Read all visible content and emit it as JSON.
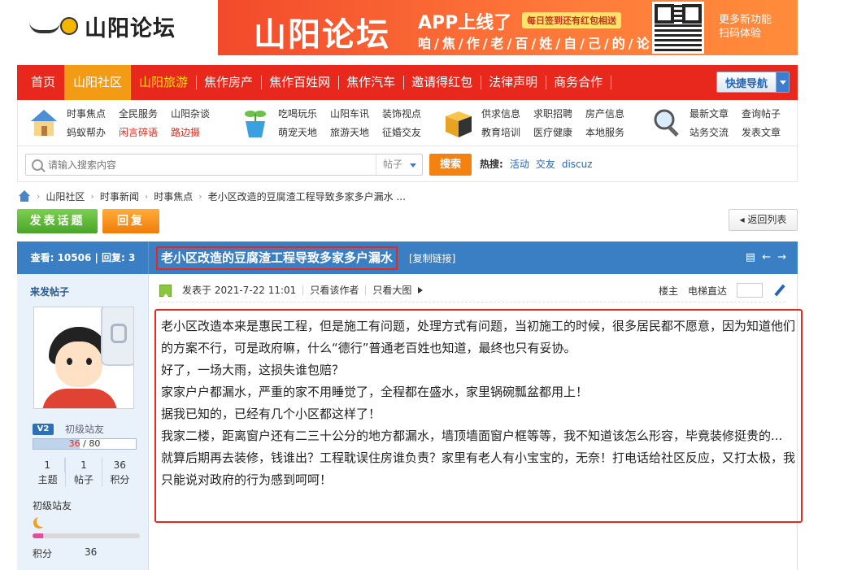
{
  "header": {
    "logo_text": "山阳论坛",
    "banner": {
      "title": "山阳论坛",
      "app_text": "APP上线了",
      "sign_badge": "每日签到还有红包相送",
      "slogan": "咱/焦/作/老/百/姓/自/己/的/论/坛",
      "qr_text_1": "更多新功能",
      "qr_text_2": "扫码体验"
    }
  },
  "nav": {
    "items": [
      {
        "label": "首页"
      },
      {
        "label": "山阳社区"
      },
      {
        "label": "山阳旅游"
      },
      {
        "label": "焦作房产"
      },
      {
        "label": "焦作百姓网"
      },
      {
        "label": "焦作汽车"
      },
      {
        "label": "邀请得红包"
      },
      {
        "label": "法律声明"
      },
      {
        "label": "商务合作"
      }
    ],
    "quick_nav": "快捷导航",
    "colors": {
      "bar": "#e8281c",
      "active": "#f49b16",
      "highlight": "#ffe000"
    }
  },
  "categories": [
    {
      "icon": "house-icon",
      "links": [
        "时事焦点",
        "全民服务",
        "山阳杂谈",
        "蚂蚁帮办",
        "闲言碎语",
        "路边摄"
      ],
      "red": [
        4,
        5
      ]
    },
    {
      "icon": "plant-pot-icon",
      "links": [
        "吃喝玩乐",
        "山阳车讯",
        "装饰视点",
        "萌宠天地",
        "旅游天地",
        "征婚交友"
      ],
      "red": []
    },
    {
      "icon": "box-icon",
      "links": [
        "供求信息",
        "求职招聘",
        "房产信息",
        "教育培训",
        "医疗健康",
        "本地服务"
      ],
      "red": []
    },
    {
      "icon": "magnifier-icon",
      "links": [
        "最新文章",
        "查询帖子",
        "站务交流",
        "发表文章"
      ],
      "red": []
    }
  ],
  "search": {
    "placeholder": "请输入搜索内容",
    "type": "帖子",
    "button": "搜索",
    "hot_label": "热搜:",
    "hot_terms": [
      "活动",
      "交友",
      "discuz"
    ]
  },
  "breadcrumb": [
    "山阳社区",
    "时事新闻",
    "时事焦点",
    "老小区改造的豆腐渣工程导致多家多户漏水 ..."
  ],
  "actions": {
    "post": "发表话题",
    "reply": "回复",
    "back": "返回列表"
  },
  "thread": {
    "stats": "查看: 10506 | 回复: 3",
    "title": "老小区改造的豆腐渣工程导致多家多户漏水",
    "copy_link": "[复制链接]"
  },
  "author": {
    "poster_label": "来发帖子",
    "level_badge": "V2",
    "level_name": "初级站友",
    "credit_current": "36",
    "credit_max": "80",
    "credit_sep": " / ",
    "credit_progress": 0.45,
    "counts": [
      {
        "value": "1",
        "label": "主题"
      },
      {
        "value": "1",
        "label": "帖子"
      },
      {
        "value": "36",
        "label": "积分"
      }
    ],
    "level_name_2": "初级站友",
    "star_progress": 0.1,
    "points_label": "积分",
    "points_value": "36"
  },
  "post": {
    "posted": "发表于 2021-7-22 11:01",
    "only_author": "只看该作者",
    "only_large": "只看大图",
    "floor": "楼主",
    "elevator": "电梯直达",
    "paragraphs": [
      "老小区改造本来是惠民工程，但是施工有问题，处理方式有问题，当初施工的时候，很多居民都不愿意，因为知道他们的方案不行，可是政府嘛，什么“德行”普通老百姓也知道，最终也只有妥协。",
      "好了，一场大雨，这损失谁包赔？",
      "家家户户都漏水，严重的家不用睡觉了，全程都在盛水，家里锅碗瓢盆都用上！",
      "据我已知的，已经有几个小区都这样了！",
      "我家二楼，距离窗户还有二三十公分的地方都漏水，墙顶墙面窗户框等等，我不知道该怎么形容，毕竟装修挺贵的...",
      "就算后期再去装修，钱谁出？工程耽误住房谁负责？家里有老人有小宝宝的，无奈！打电话给社区反应，又打太极，我只能说对政府的行为感到呵呵！"
    ]
  }
}
